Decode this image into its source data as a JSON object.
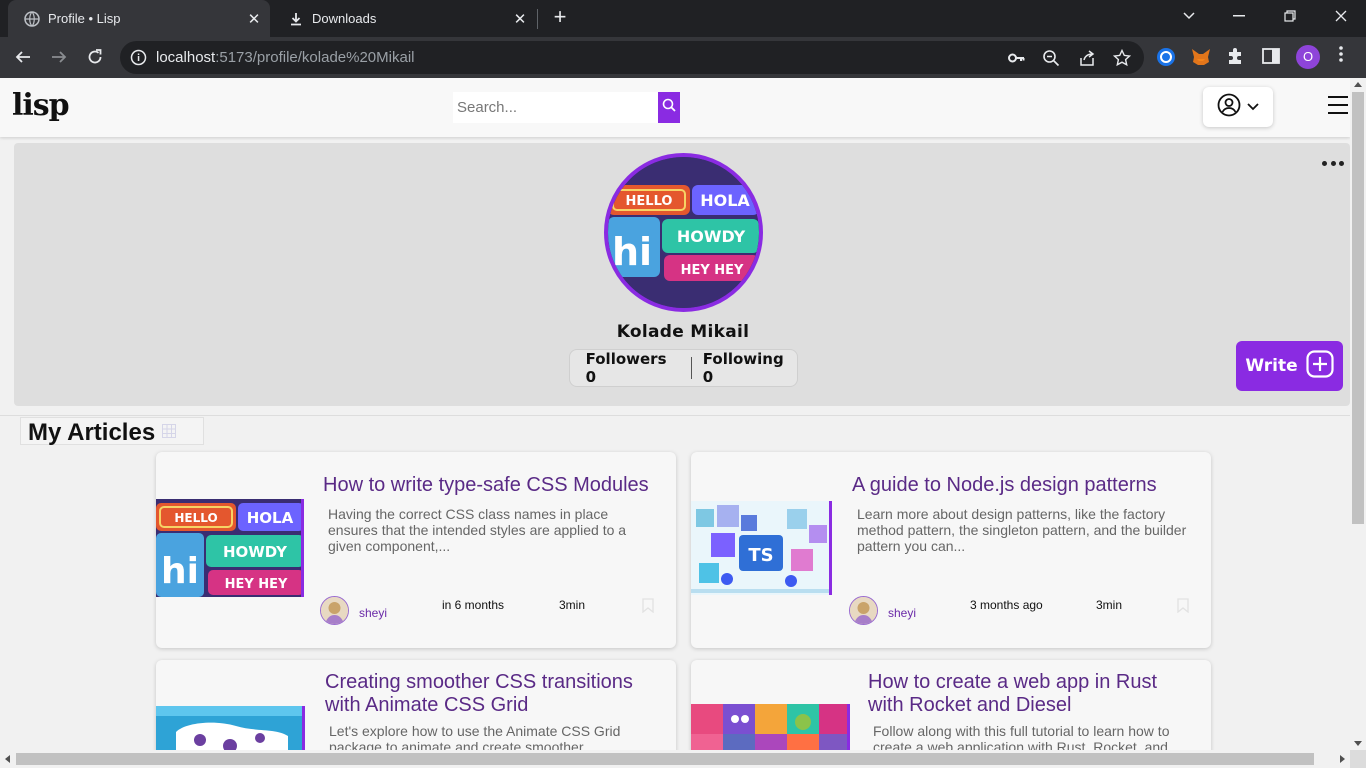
{
  "browser": {
    "tabs": [
      {
        "title": "Profile • Lisp",
        "active": true
      },
      {
        "title": "Downloads",
        "active": false
      }
    ],
    "url_host": "localhost",
    "url_rest": ":5173/profile/kolade%20Mikail",
    "profile_initial": "O"
  },
  "header": {
    "logo": "lisp",
    "search_placeholder": "Search..."
  },
  "profile": {
    "name": "Kolade Mikail",
    "followers": "Followers 0",
    "following": "Following 0",
    "write_label": "Write"
  },
  "articles_section": {
    "title": "My Articles"
  },
  "articles": [
    {
      "title": "How to write type-safe CSS Modules",
      "excerpt": "Having the correct CSS class names in place ensures that the intended styles are applied to a given component,...",
      "author": "sheyi",
      "date": "in 6 months",
      "read_time": "3min"
    },
    {
      "title": "A guide to Node.js design patterns",
      "excerpt": "Learn more about design patterns, like the factory method pattern, the singleton pattern, and the builder pattern you can...",
      "author": "sheyi",
      "date": "3 months ago",
      "read_time": "3min"
    },
    {
      "title": "Creating smoother CSS transitions with Animate CSS Grid",
      "excerpt": "Let's explore how to use the Animate CSS Grid package to animate and create smoother..."
    },
    {
      "title": "How to create a web app in Rust with Rocket and Diesel",
      "excerpt": "Follow along with this full tutorial to learn how to create a web application with Rust, Rocket, and..."
    }
  ],
  "colors": {
    "accent": "#8a2be2",
    "title_purple": "#5a2a86",
    "chrome_dark": "#202124",
    "chrome_toolbar": "#35363a"
  }
}
